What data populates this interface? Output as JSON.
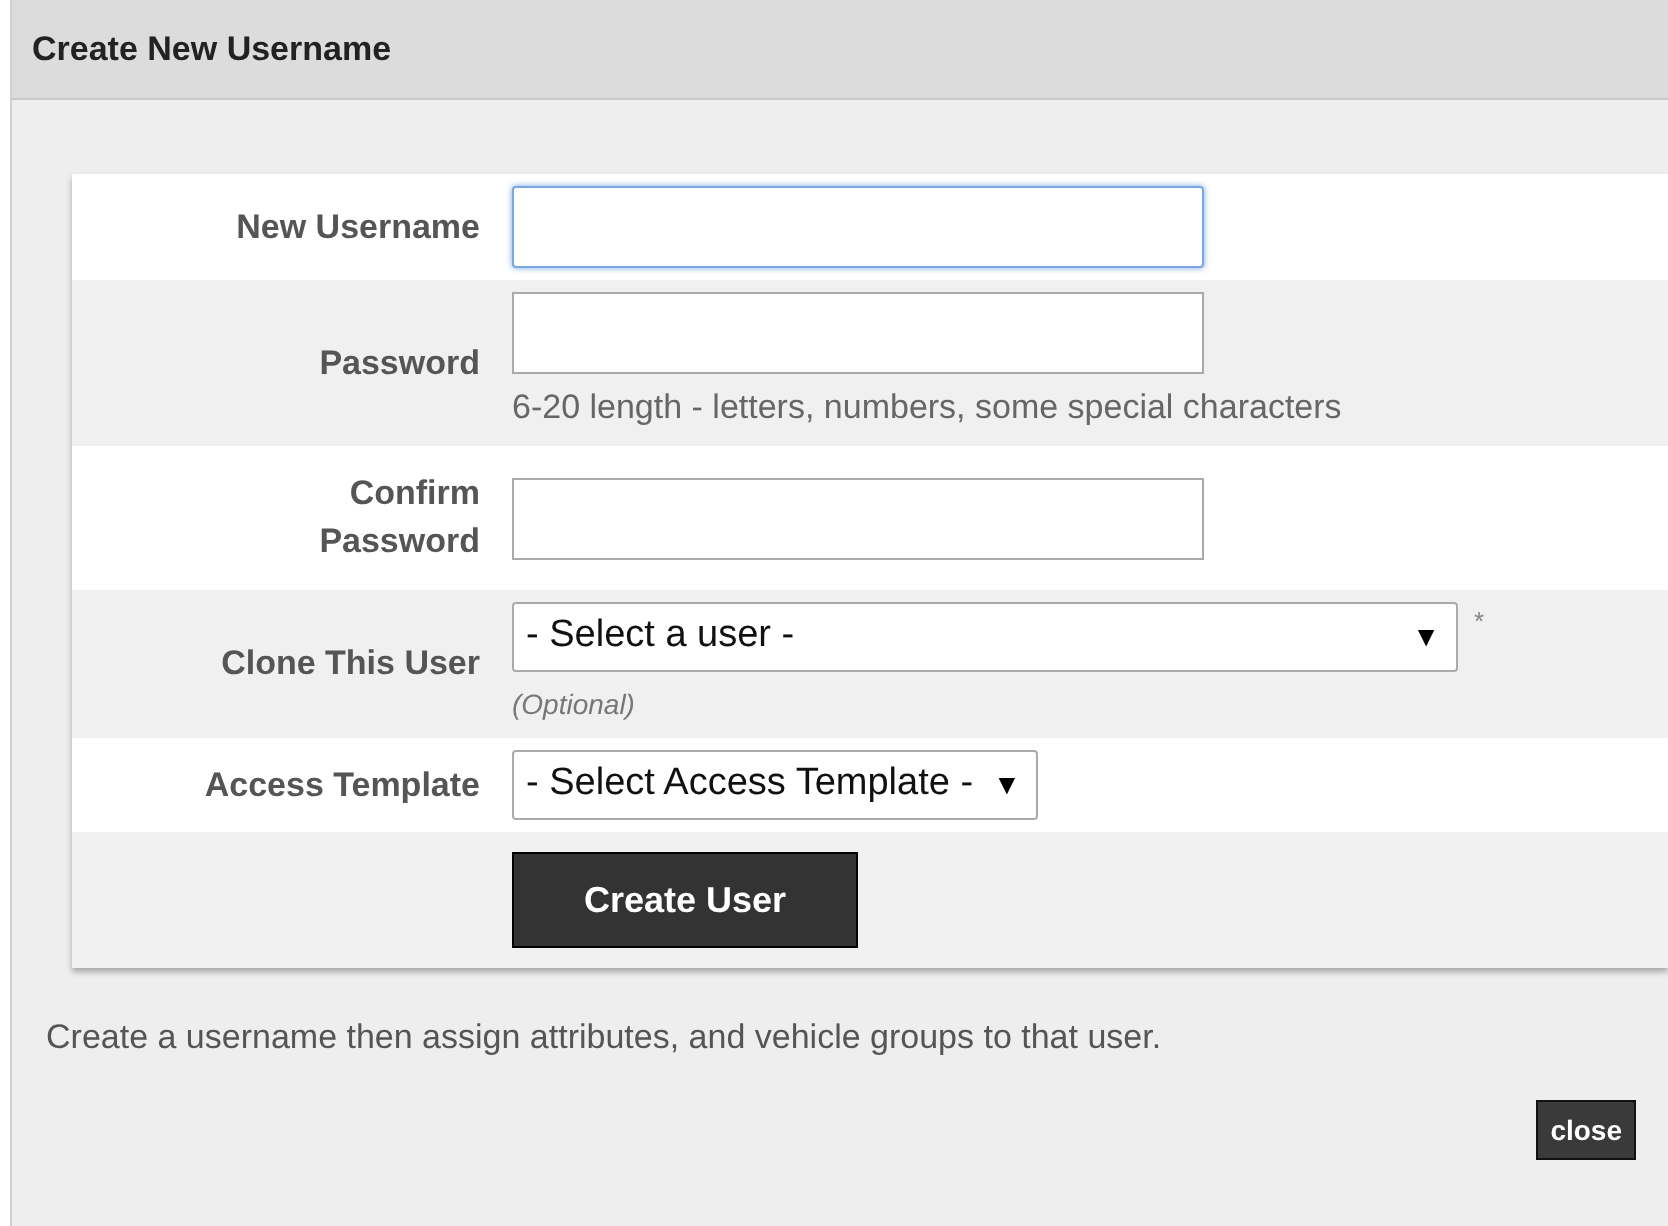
{
  "window": {
    "title": "Create New Username"
  },
  "form": {
    "rows": [
      {
        "kind": "text",
        "label": "New Username",
        "focused": true
      },
      {
        "kind": "password",
        "label": "Password",
        "hint": "6-20 length - letters, numbers, some special characters",
        "focused": false
      },
      {
        "kind": "password",
        "label": "Confirm Password",
        "focused": false
      },
      {
        "kind": "select",
        "label": "Clone This User",
        "value": "- Select a user -",
        "arrow": "▼",
        "required_mark": "*",
        "note": "(Optional)"
      },
      {
        "kind": "select",
        "label": "Access Template",
        "value": "- Select Access Template -",
        "arrow": "▼"
      },
      {
        "kind": "submit",
        "label": "Create User"
      }
    ]
  },
  "footer": {
    "text": "Create a username then assign attributes, and vehicle groups to that user.",
    "close_button": "close"
  }
}
